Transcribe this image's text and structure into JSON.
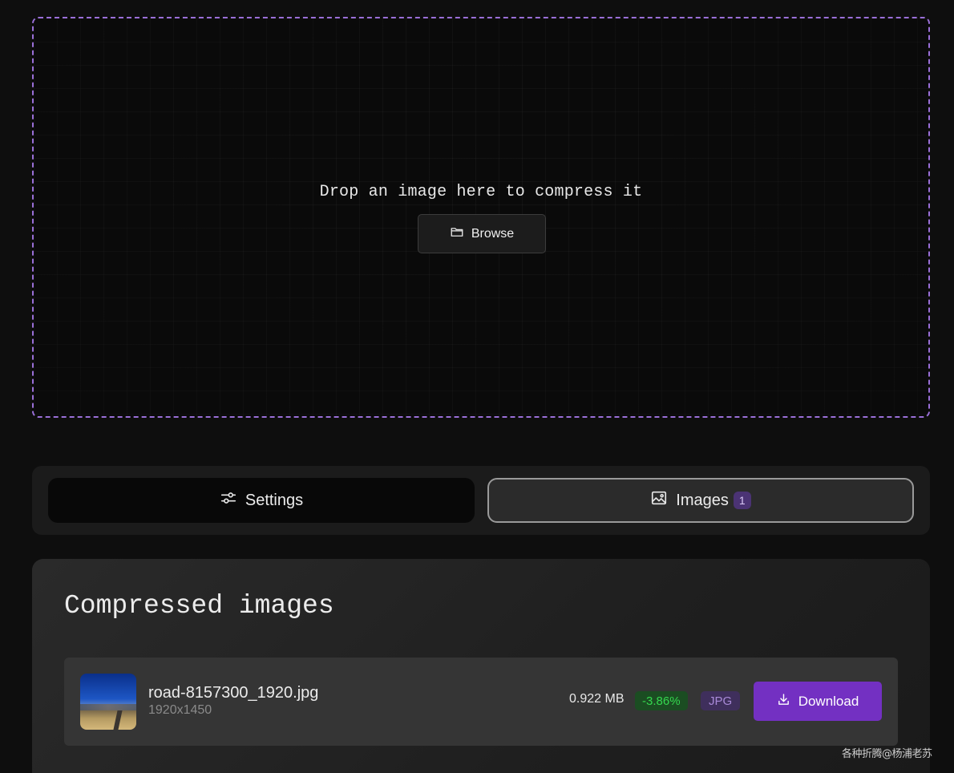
{
  "dropzone": {
    "prompt": "Drop an image here to compress it",
    "browse_label": "Browse",
    "browse_icon": "folder-icon",
    "border_color": "#9a6fd8"
  },
  "tabs": {
    "settings": {
      "label": "Settings",
      "icon": "sliders-icon"
    },
    "images": {
      "label": "Images",
      "icon": "image-icon",
      "count": "1"
    }
  },
  "compressed": {
    "title": "Compressed images",
    "items": [
      {
        "filename": "road-8157300_1920.jpg",
        "dimensions": "1920x1450",
        "size": "0.922 MB",
        "change": "-3.86%",
        "format": "JPG",
        "download_label": "Download",
        "download_icon": "download-icon"
      }
    ]
  },
  "watermark": "各种折腾@杨浦老苏",
  "colors": {
    "accent": "#7330c2",
    "badge_bg": "#4b3374",
    "positive_green": "#35d84f"
  }
}
